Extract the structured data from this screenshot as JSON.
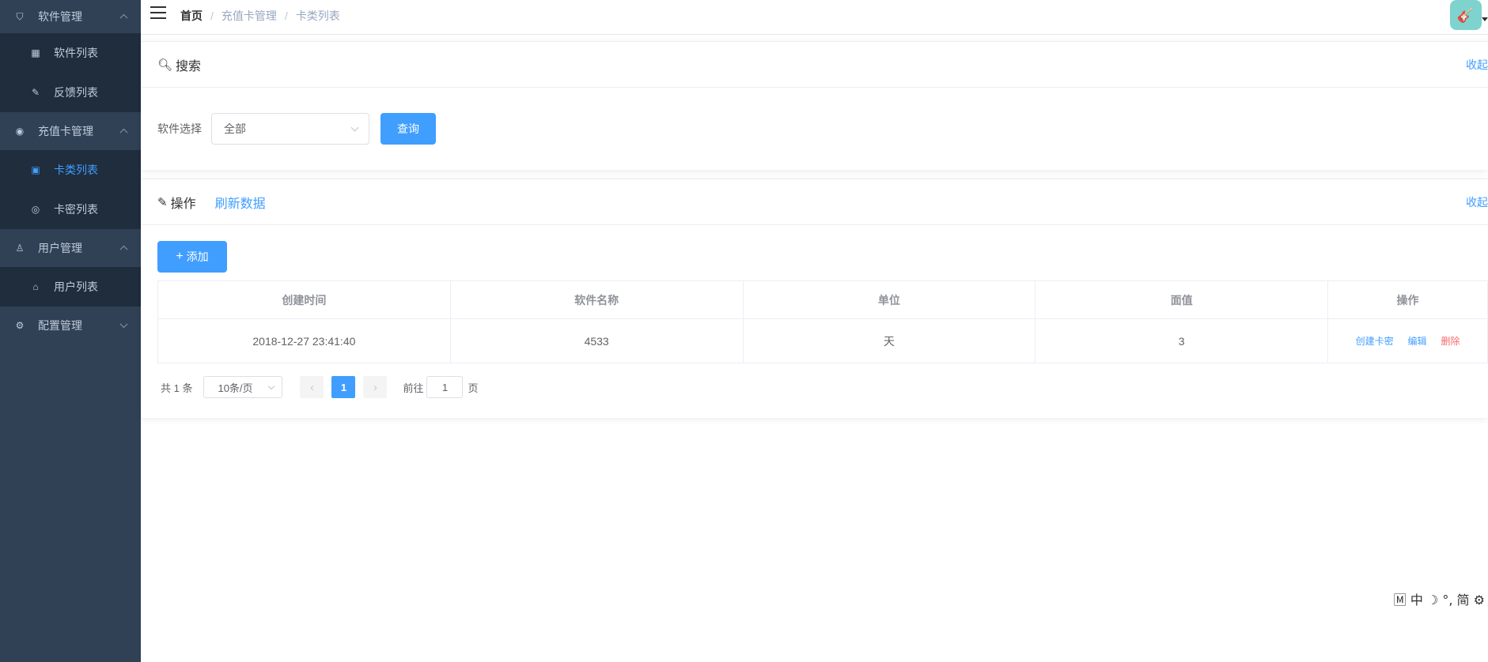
{
  "sidebar": {
    "groups": [
      {
        "label": "软件管理",
        "icon": "shield-icon",
        "items": [
          {
            "label": "软件列表",
            "icon": "grid-icon"
          },
          {
            "label": "反馈列表",
            "icon": "edit-icon"
          }
        ]
      },
      {
        "label": "充值卡管理",
        "icon": "coin-icon",
        "items": [
          {
            "label": "卡类列表",
            "icon": "card-icon",
            "active": true
          },
          {
            "label": "卡密列表",
            "icon": "target-icon"
          }
        ]
      },
      {
        "label": "用户管理",
        "icon": "user-icon",
        "items": [
          {
            "label": "用户列表",
            "icon": "hat-icon"
          }
        ]
      },
      {
        "label": "配置管理",
        "icon": "gear-icon",
        "items": []
      }
    ]
  },
  "header": {
    "breadcrumb": [
      "首页",
      "充值卡管理",
      "卡类列表"
    ],
    "separator": "/"
  },
  "search": {
    "title": "搜索",
    "collapse": "收起",
    "select_label": "软件选择",
    "select_value": "全部",
    "query_button": "查询"
  },
  "ops": {
    "title": "操作",
    "refresh": "刷新数据",
    "collapse": "收起",
    "add_button": "添加"
  },
  "table": {
    "columns": [
      "创建时间",
      "软件名称",
      "单位",
      "面值",
      "操作"
    ],
    "rows": [
      {
        "created": "2018-12-27 23:41:40",
        "software": "4533",
        "unit": "天",
        "value": "3",
        "actions": [
          "创建卡密",
          "编辑",
          "删除"
        ]
      }
    ]
  },
  "pagination": {
    "total": "共 1 条",
    "page_size": "10条/页",
    "current_page": "1",
    "goto_prefix": "前往",
    "goto_value": "1",
    "goto_suffix": "页"
  },
  "ime_bar": "🄼 中 ☽ °, 简 ⚙",
  "colors": {
    "sidebar_bg": "#304156",
    "submenu_bg": "#1f2d3d",
    "primary": "#409eff",
    "danger": "#f56c6c"
  }
}
